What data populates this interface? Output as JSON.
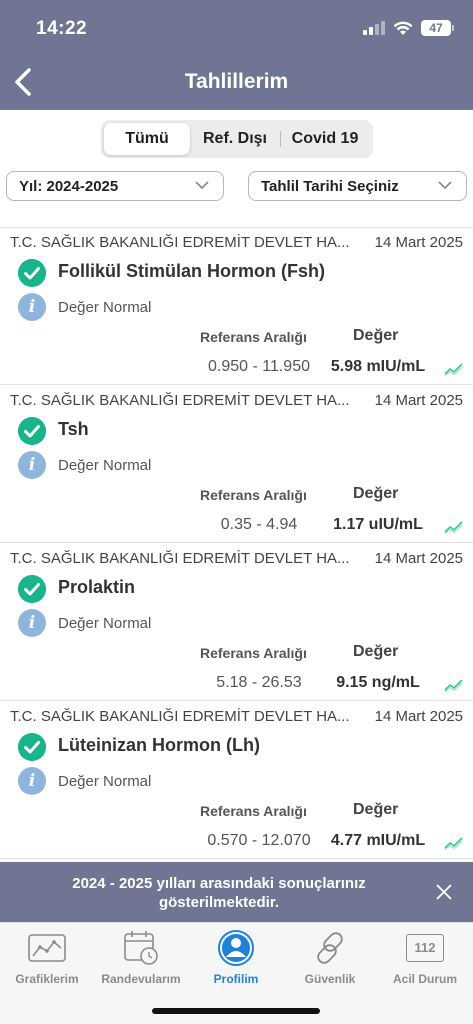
{
  "status_bar": {
    "time": "14:22",
    "battery": "47"
  },
  "header": {
    "title": "Tahlillerim",
    "back_icon": "chevron-left-icon"
  },
  "segments": [
    {
      "label": "Tümü",
      "active": true
    },
    {
      "label": "Ref. Dışı",
      "active": false
    },
    {
      "label": "Covid 19",
      "active": false
    }
  ],
  "filters": {
    "year": "Yıl: 2024-2025",
    "date": "Tahlil Tarihi Seçiniz"
  },
  "list": {
    "ref_header": "Referans Aralığı",
    "value_header": "Değer",
    "items": [
      {
        "institution": "T.C. SAĞLIK BAKANLIĞI EDREMİT DEVLET HA...",
        "date": "14 Mart 2025",
        "name": "Follikül Stimülan Hormon (Fsh)",
        "status": "Değer Normal",
        "ref_range": "0.950 - 11.950",
        "value": "5.98 mIU/mL"
      },
      {
        "institution": "T.C. SAĞLIK BAKANLIĞI EDREMİT DEVLET HA...",
        "date": "14 Mart 2025",
        "name": "Tsh",
        "status": "Değer Normal",
        "ref_range": "0.35 - 4.94",
        "value": "1.17 uIU/mL"
      },
      {
        "institution": "T.C. SAĞLIK BAKANLIĞI EDREMİT DEVLET HA...",
        "date": "14 Mart 2025",
        "name": "Prolaktin",
        "status": "Değer Normal",
        "ref_range": "5.18 - 26.53",
        "value": "9.15 ng/mL"
      },
      {
        "institution": "T.C. SAĞLIK BAKANLIĞI EDREMİT DEVLET HA...",
        "date": "14 Mart 2025",
        "name": "Lüteinizan Hormon (Lh)",
        "status": "Değer Normal",
        "ref_range": "0.570 - 12.070",
        "value": "4.77 mIU/mL"
      }
    ]
  },
  "notice": {
    "text": "2024 - 2025 yılları arasındaki sonuçlarınız gösterilmektedir."
  },
  "tabbar": {
    "items": [
      {
        "label": "Grafiklerim",
        "icon": "chart-icon"
      },
      {
        "label": "Randevularım",
        "icon": "calendar-clock-icon"
      },
      {
        "label": "Profilim",
        "icon": "profile-icon",
        "active": true
      },
      {
        "label": "Güvenlik",
        "icon": "link-icon"
      },
      {
        "label": "Acil Durum",
        "icon": "emergency-112-icon",
        "badge": "112"
      }
    ]
  },
  "colors": {
    "header": "#6f7593",
    "check": "#18b48b",
    "info": "#8fb5dd",
    "active_tab": "#1e82d8",
    "trend": "#32c98f"
  }
}
